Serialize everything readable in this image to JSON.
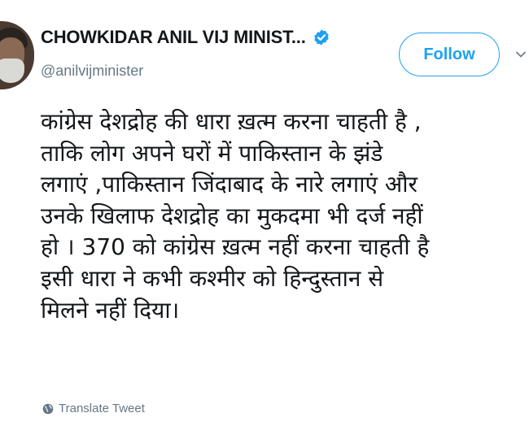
{
  "author": {
    "display_name": "CHOWKIDAR ANIL VIJ MINIST...",
    "handle": "@anilvijminister",
    "verified": true
  },
  "follow_button": {
    "label": "Follow"
  },
  "tweet": {
    "lines": [
      "कांग्रेस देशद्रोह की धारा ख़त्म करना चाहती है ,",
      "ताकि लोग अपने घरों में पाकिस्तान के झंडे",
      "लगाएं ,पाकिस्तान  जिंदाबाद के नारे लगाएं और",
      "उनके  खिलाफ देशद्रोह का मुकदमा भी दर्ज नहीं",
      "हो । 370 को कांग्रेस ख़त्म नहीं करना चाहती है",
      "इसी धारा ने कभी कश्मीर को हिन्दुस्तान से",
      "मिलने नहीं दिया।"
    ]
  },
  "translate": {
    "label": "Translate Tweet",
    "icon": "globe-icon"
  },
  "colors": {
    "accent": "#1da1f2",
    "muted": "#657786",
    "text": "#14171a"
  }
}
